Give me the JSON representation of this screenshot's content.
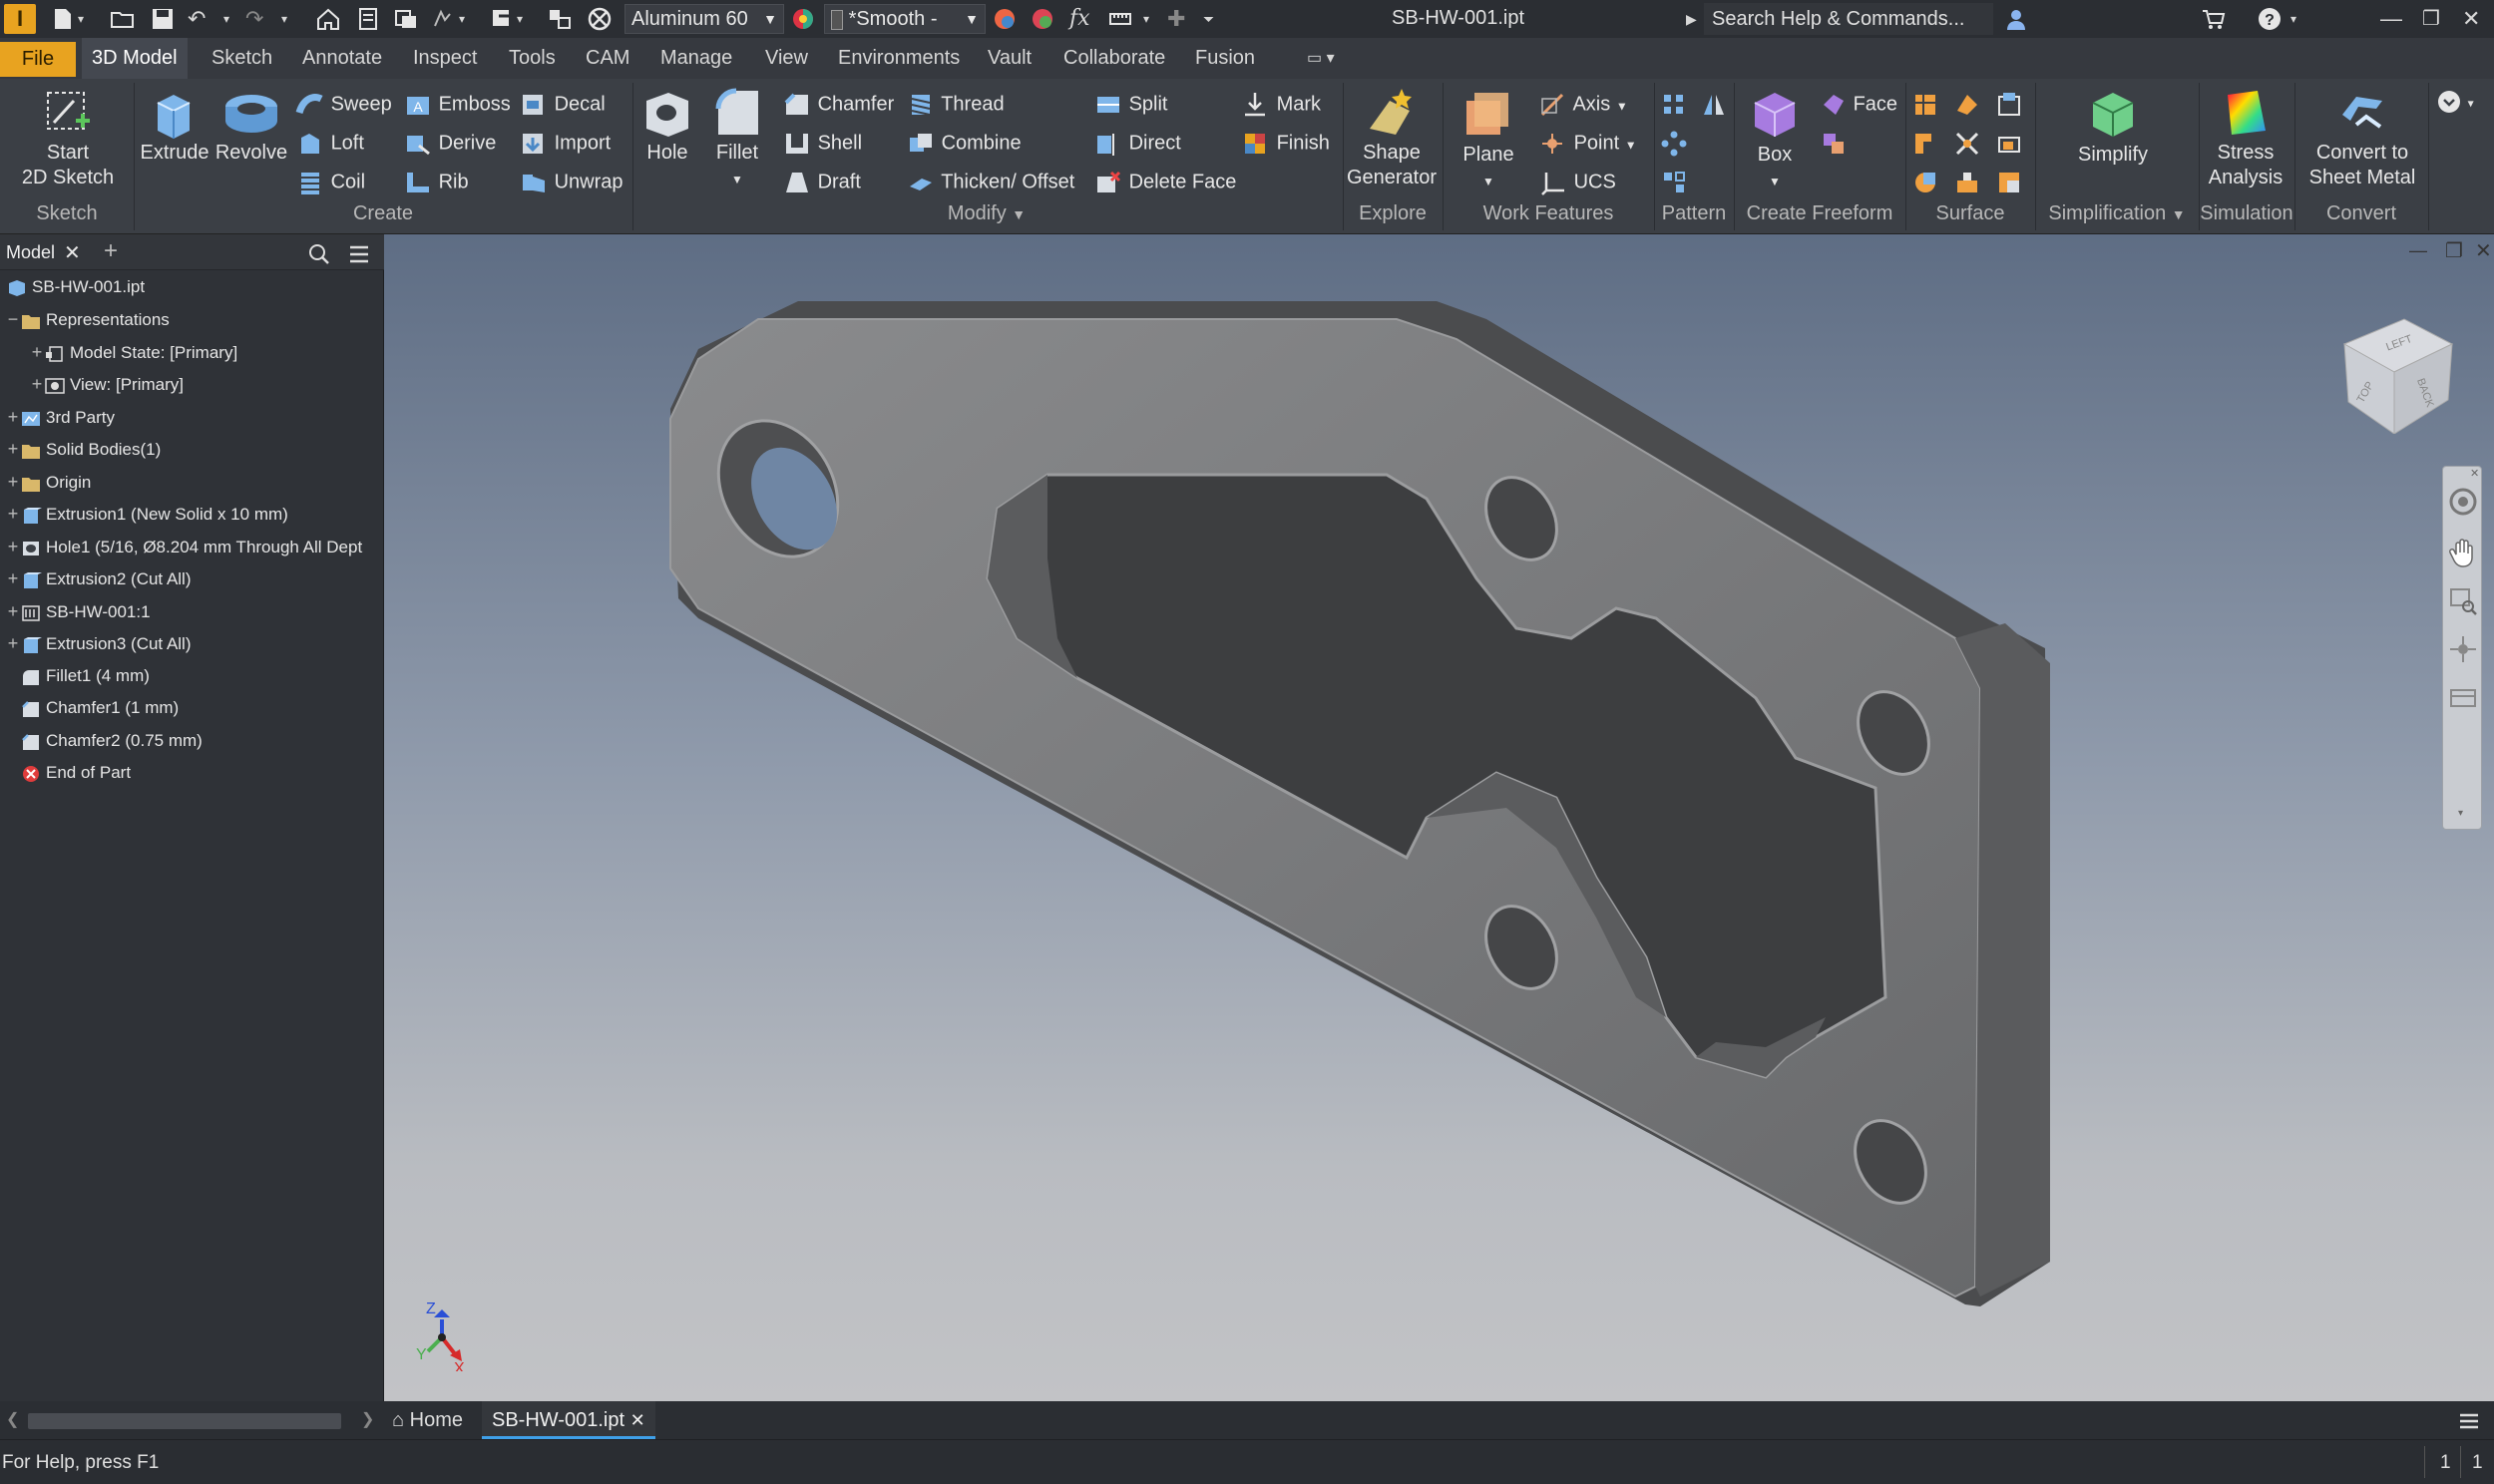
{
  "app": {
    "logo": "I",
    "document_title": "SB-HW-001.ipt"
  },
  "quick_access": {
    "material": "Aluminum 60",
    "appearance": "*Smooth -",
    "search_placeholder": "Search Help & Commands..."
  },
  "tabs": [
    {
      "label": "File"
    },
    {
      "label": "3D Model"
    },
    {
      "label": "Sketch"
    },
    {
      "label": "Annotate"
    },
    {
      "label": "Inspect"
    },
    {
      "label": "Tools"
    },
    {
      "label": "CAM"
    },
    {
      "label": "Manage"
    },
    {
      "label": "View"
    },
    {
      "label": "Environments"
    },
    {
      "label": "Vault"
    },
    {
      "label": "Collaborate"
    },
    {
      "label": "Fusion"
    }
  ],
  "active_tab": "3D Model",
  "ribbon": {
    "sketch": {
      "start_line1": "Start",
      "start_line2": "2D Sketch",
      "group": "Sketch"
    },
    "create": {
      "extrude": "Extrude",
      "revolve": "Revolve",
      "sweep": "Sweep",
      "loft": "Loft",
      "coil": "Coil",
      "emboss": "Emboss",
      "derive": "Derive",
      "rib": "Rib",
      "decal": "Decal",
      "import": "Import",
      "unwrap": "Unwrap",
      "group": "Create"
    },
    "modify": {
      "hole": "Hole",
      "fillet": "Fillet",
      "chamfer": "Chamfer",
      "shell": "Shell",
      "draft": "Draft",
      "thread": "Thread",
      "combine": "Combine",
      "thicken": "Thicken/ Offset",
      "split": "Split",
      "direct": "Direct",
      "delete_face": "Delete Face",
      "mark": "Mark",
      "finish": "Finish",
      "group": "Modify"
    },
    "explore": {
      "line1": "Shape",
      "line2": "Generator",
      "group": "Explore"
    },
    "work": {
      "plane": "Plane",
      "axis": "Axis",
      "point": "Point",
      "ucs": "UCS",
      "group": "Work Features"
    },
    "pattern": {
      "group": "Pattern"
    },
    "freeform": {
      "box": "Box",
      "face": "Face",
      "group": "Create Freeform"
    },
    "surface": {
      "group": "Surface"
    },
    "simplification": {
      "simplify": "Simplify",
      "group": "Simplification"
    },
    "simulation": {
      "line1": "Stress",
      "line2": "Analysis",
      "group": "Simulation"
    },
    "convert": {
      "line1": "Convert to",
      "line2": "Sheet Metal",
      "group": "Convert"
    }
  },
  "browser": {
    "title": "Model",
    "nodes": [
      {
        "label": "SB-HW-001.ipt"
      },
      {
        "label": "Representations"
      },
      {
        "label": "Model State: [Primary]"
      },
      {
        "label": "View: [Primary]"
      },
      {
        "label": "3rd Party"
      },
      {
        "label": "Solid Bodies(1)"
      },
      {
        "label": "Origin"
      },
      {
        "label": "Extrusion1 (New Solid x 10 mm)"
      },
      {
        "label": "Hole1 (5/16, Ø8.204 mm Through All Dept"
      },
      {
        "label": "Extrusion2 (Cut All)"
      },
      {
        "label": "SB-HW-001:1"
      },
      {
        "label": "Extrusion3 (Cut All)"
      },
      {
        "label": "Fillet1 (4 mm)"
      },
      {
        "label": "Chamfer1 (1 mm)"
      },
      {
        "label": "Chamfer2 (0.75 mm)"
      },
      {
        "label": "End of Part"
      }
    ]
  },
  "viewcube": {
    "faces": [
      "LEFT",
      "TOP",
      "BACK"
    ]
  },
  "triad": {
    "x": "X",
    "y": "Y",
    "z": "Z"
  },
  "doc_tabs": {
    "home": "Home",
    "file": "SB-HW-001.ipt"
  },
  "status": {
    "help": "For Help, press F1",
    "count1": "1",
    "count2": "1"
  }
}
